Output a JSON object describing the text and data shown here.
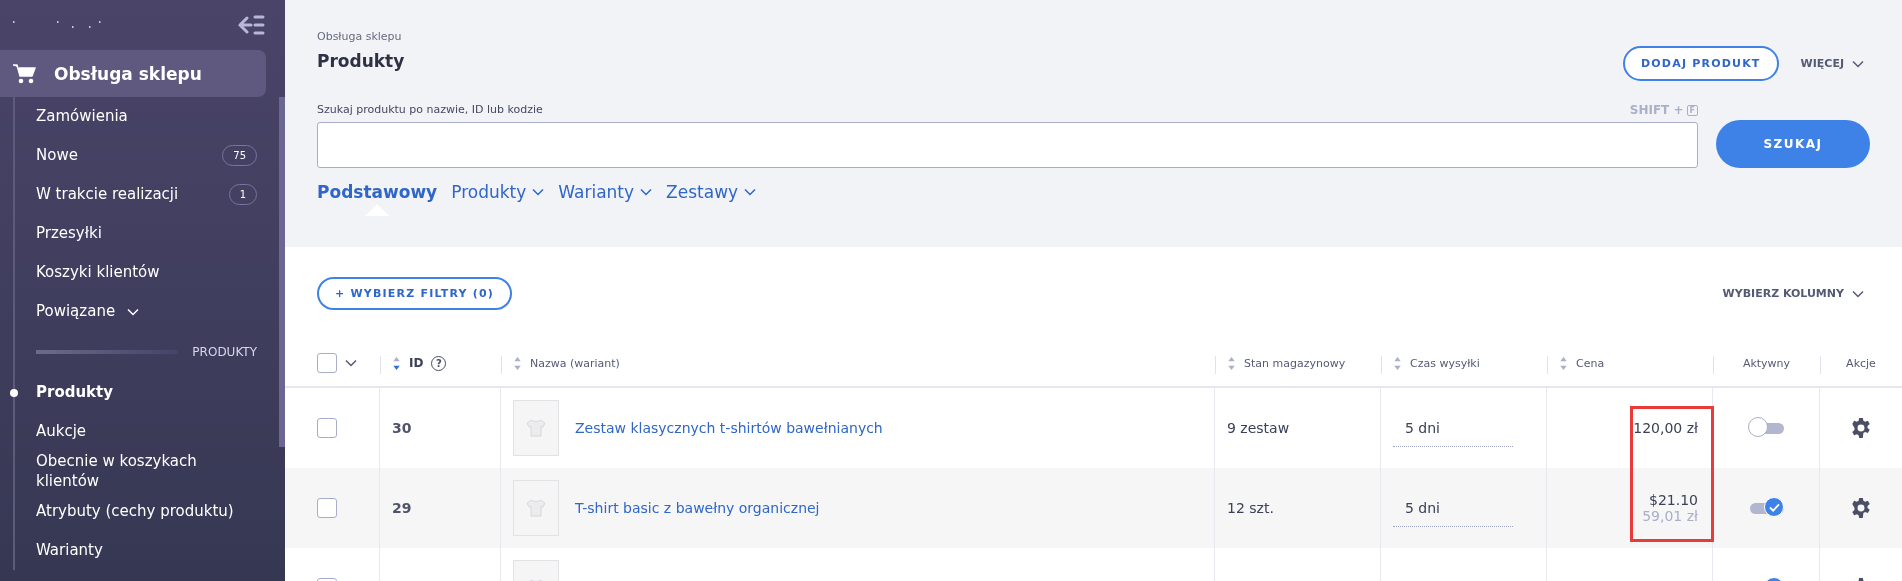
{
  "sidebar": {
    "section": {
      "label": "Obsługa sklepu",
      "selected": true
    },
    "items": [
      {
        "kind": "link",
        "label": "Zamówienia",
        "selected": false
      },
      {
        "kind": "link",
        "label": "Nowe",
        "badge": "75",
        "selected": false
      },
      {
        "kind": "link",
        "label": "W trakcie realizacji",
        "badge": "1",
        "selected": false
      },
      {
        "kind": "link",
        "label": "Przesyłki",
        "selected": false
      },
      {
        "kind": "link",
        "label": "Koszyki klientów",
        "selected": false
      },
      {
        "kind": "dropdown",
        "label": "Powiązane",
        "selected": false
      },
      {
        "kind": "heading",
        "label": "PRODUKTY"
      },
      {
        "kind": "link",
        "label": "Produkty",
        "selected": true
      },
      {
        "kind": "link",
        "label": "Aukcje",
        "selected": false
      },
      {
        "kind": "link",
        "label": "Obecnie w koszykach klientów",
        "selected": false
      },
      {
        "kind": "link",
        "label": "Atrybuty (cechy produktu)",
        "selected": false
      },
      {
        "kind": "link",
        "label": "Warianty",
        "selected": false
      }
    ]
  },
  "header": {
    "breadcrumb": "Obsługa sklepu",
    "title": "Produkty",
    "add_button": "DODAJ PRODUKT",
    "more_button": "WIĘCEJ"
  },
  "search": {
    "label": "Szukaj produktu po nazwie, ID lub kodzie",
    "shortcut": "SHIFT +",
    "shortcut_key": "F",
    "button": "SZUKAJ"
  },
  "tabs": [
    {
      "label": "Podstawowy",
      "kind": "plain",
      "selected": true
    },
    {
      "label": "Produkty",
      "kind": "dropdown",
      "selected": false
    },
    {
      "label": "Warianty",
      "kind": "dropdown",
      "selected": false
    },
    {
      "label": "Zestawy",
      "kind": "dropdown",
      "selected": false
    }
  ],
  "filters_button": "+ WYBIERZ FILTRY (0)",
  "columns_button": "WYBIERZ KOLUMNY",
  "table": {
    "select_all_checked": false,
    "columns": [
      {
        "label": "ID",
        "sortable": true,
        "sorted": true,
        "help": "?"
      },
      {
        "label": "Nazwa (wariant)",
        "sortable": true,
        "sorted": false
      },
      {
        "label": "Stan magazynowy",
        "sortable": true,
        "sorted": false
      },
      {
        "label": "Czas wysyłki",
        "sortable": true,
        "sorted": false
      },
      {
        "label": "Cena",
        "sortable": true,
        "sorted": false
      },
      {
        "label": "Aktywny",
        "sortable": false
      },
      {
        "label": "Akcje",
        "sortable": false
      }
    ],
    "rows": [
      {
        "checked": false,
        "id": "30",
        "name": "Zestaw klasycznych t-shirtów bawełnianych",
        "stock": "9 zestaw",
        "shipping": "5 dni",
        "price": "120,00 zł",
        "active": false,
        "price_highlighted": true
      },
      {
        "checked": false,
        "id": "29",
        "name": "T-shirt basic z bawełny organicznej",
        "stock": "12 szt.",
        "shipping": "5 dni",
        "price": "$21.10",
        "price_secondary": "59,01 zł",
        "active": true,
        "price_highlighted": true
      },
      {
        "checked": false,
        "active": true,
        "price_highlighted": false
      }
    ]
  }
}
